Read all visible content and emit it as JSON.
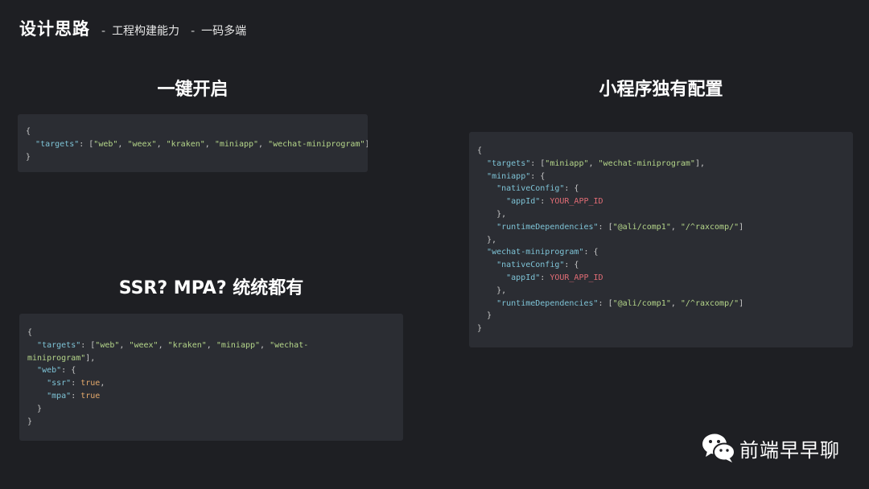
{
  "header": {
    "title": "设计思路",
    "crumbs": [
      "工程构建能力",
      "一码多端"
    ],
    "separator": "-"
  },
  "sections": {
    "one_click": {
      "heading": "一键开启",
      "code": [
        [
          [
            "{",
            "punct"
          ]
        ],
        [
          [
            "  ",
            "punct"
          ],
          [
            "\"targets\"",
            "key"
          ],
          [
            ": [",
            "punct"
          ],
          [
            "\"web\"",
            "str"
          ],
          [
            ", ",
            "punct"
          ],
          [
            "\"weex\"",
            "str"
          ],
          [
            ", ",
            "punct"
          ],
          [
            "\"kraken\"",
            "str"
          ],
          [
            ", ",
            "punct"
          ],
          [
            "\"miniapp\"",
            "str"
          ],
          [
            ", ",
            "punct"
          ],
          [
            "\"wechat-miniprogram\"",
            "str"
          ],
          [
            "]",
            "punct"
          ]
        ],
        [
          [
            "}",
            "punct"
          ]
        ]
      ]
    },
    "ssr_mpa": {
      "heading": "SSR? MPA? 统统都有",
      "code": [
        [
          [
            "{",
            "punct"
          ]
        ],
        [
          [
            "  ",
            "punct"
          ],
          [
            "\"targets\"",
            "key"
          ],
          [
            ": [",
            "punct"
          ],
          [
            "\"web\"",
            "str"
          ],
          [
            ", ",
            "punct"
          ],
          [
            "\"weex\"",
            "str"
          ],
          [
            ", ",
            "punct"
          ],
          [
            "\"kraken\"",
            "str"
          ],
          [
            ", ",
            "punct"
          ],
          [
            "\"miniapp\"",
            "str"
          ],
          [
            ", ",
            "punct"
          ],
          [
            "\"wechat-",
            "str"
          ]
        ],
        [
          [
            "miniprogram\"",
            "str"
          ],
          [
            "],",
            "punct"
          ]
        ],
        [
          [
            "  ",
            "punct"
          ],
          [
            "\"web\"",
            "key"
          ],
          [
            ": {",
            "punct"
          ]
        ],
        [
          [
            "    ",
            "punct"
          ],
          [
            "\"ssr\"",
            "key"
          ],
          [
            ": ",
            "punct"
          ],
          [
            "true",
            "bool"
          ],
          [
            ",",
            "punct"
          ]
        ],
        [
          [
            "    ",
            "punct"
          ],
          [
            "\"mpa\"",
            "key"
          ],
          [
            ": ",
            "punct"
          ],
          [
            "true",
            "bool"
          ]
        ],
        [
          [
            "  }",
            "punct"
          ]
        ],
        [
          [
            "}",
            "punct"
          ]
        ]
      ]
    },
    "miniprogram_config": {
      "heading": "小程序独有配置",
      "code": [
        [
          [
            "{",
            "punct"
          ]
        ],
        [
          [
            "  ",
            "punct"
          ],
          [
            "\"targets\"",
            "key"
          ],
          [
            ": [",
            "punct"
          ],
          [
            "\"miniapp\"",
            "str"
          ],
          [
            ", ",
            "punct"
          ],
          [
            "\"wechat-miniprogram\"",
            "str"
          ],
          [
            "],",
            "punct"
          ]
        ],
        [
          [
            "  ",
            "punct"
          ],
          [
            "\"miniapp\"",
            "key"
          ],
          [
            ": {",
            "punct"
          ]
        ],
        [
          [
            "    ",
            "punct"
          ],
          [
            "\"nativeConfig\"",
            "key"
          ],
          [
            ": {",
            "punct"
          ]
        ],
        [
          [
            "      ",
            "punct"
          ],
          [
            "\"appId\"",
            "key"
          ],
          [
            ": ",
            "punct"
          ],
          [
            "YOUR_APP_ID",
            "var"
          ]
        ],
        [
          [
            "    },",
            "punct"
          ]
        ],
        [
          [
            "    ",
            "punct"
          ],
          [
            "\"runtimeDependencies\"",
            "key"
          ],
          [
            ": [",
            "punct"
          ],
          [
            "\"@ali/comp1\"",
            "str"
          ],
          [
            ", ",
            "punct"
          ],
          [
            "\"/^raxcomp/\"",
            "str"
          ],
          [
            "]",
            "punct"
          ]
        ],
        [
          [
            "  },",
            "punct"
          ]
        ],
        [
          [
            "  ",
            "punct"
          ],
          [
            "\"wechat-miniprogram\"",
            "key"
          ],
          [
            ": {",
            "punct"
          ]
        ],
        [
          [
            "    ",
            "punct"
          ],
          [
            "\"nativeConfig\"",
            "key"
          ],
          [
            ": {",
            "punct"
          ]
        ],
        [
          [
            "      ",
            "punct"
          ],
          [
            "\"appId\"",
            "key"
          ],
          [
            ": ",
            "punct"
          ],
          [
            "YOUR_APP_ID",
            "var"
          ]
        ],
        [
          [
            "    },",
            "punct"
          ]
        ],
        [
          [
            "    ",
            "punct"
          ],
          [
            "\"runtimeDependencies\"",
            "key"
          ],
          [
            ": [",
            "punct"
          ],
          [
            "\"@ali/comp1\"",
            "str"
          ],
          [
            ", ",
            "punct"
          ],
          [
            "\"/^raxcomp/\"",
            "str"
          ],
          [
            "]",
            "punct"
          ]
        ],
        [
          [
            "  }",
            "punct"
          ]
        ],
        [
          [
            "}",
            "punct"
          ]
        ]
      ]
    }
  },
  "watermark": {
    "icon": "wechat-icon",
    "text": "前端早早聊"
  },
  "colors": {
    "background": "#1e1f23",
    "code_background": "#2b2d33",
    "key": "#7ec3d6",
    "string": "#b5d68a",
    "boolean": "#e3a86b",
    "variable": "#e06c75"
  }
}
